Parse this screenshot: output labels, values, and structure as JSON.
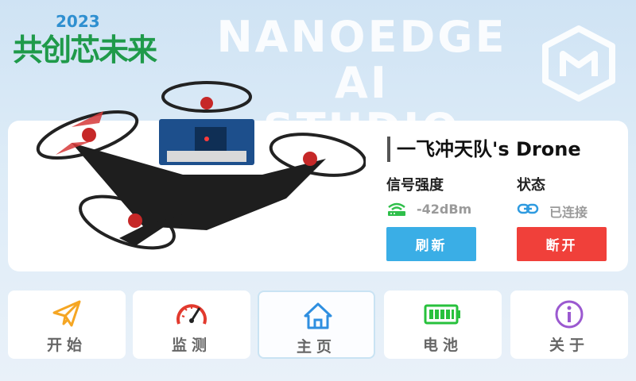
{
  "header": {
    "event_year": "2023",
    "event_name": "共创芯未来",
    "brand_line1": "NANOEDGE AI",
    "brand_line2": "STUDIO"
  },
  "device": {
    "title": "一飞冲天队's Drone",
    "signal_label": "信号强度",
    "signal_value": "-42dBm",
    "status_label": "状态",
    "status_value": "已连接",
    "refresh_button": "刷新",
    "disconnect_button": "断开"
  },
  "nav": {
    "items": [
      {
        "label": "开始",
        "icon": "paper-plane-icon"
      },
      {
        "label": "监测",
        "icon": "gauge-icon"
      },
      {
        "label": "主页",
        "icon": "home-icon"
      },
      {
        "label": "电池",
        "icon": "battery-icon"
      },
      {
        "label": "关于",
        "icon": "info-icon"
      }
    ],
    "active": "主页"
  },
  "colors": {
    "refresh": "#3aaee6",
    "disconnect": "#f0403a",
    "signal_icon": "#2fbf4a",
    "link_icon": "#2f9be0",
    "plane_icon": "#f5a623",
    "gauge_icon": "#e23a2e",
    "home_icon": "#2f8fe0",
    "battery_icon": "#27c13c",
    "info_icon": "#9b59d0"
  }
}
